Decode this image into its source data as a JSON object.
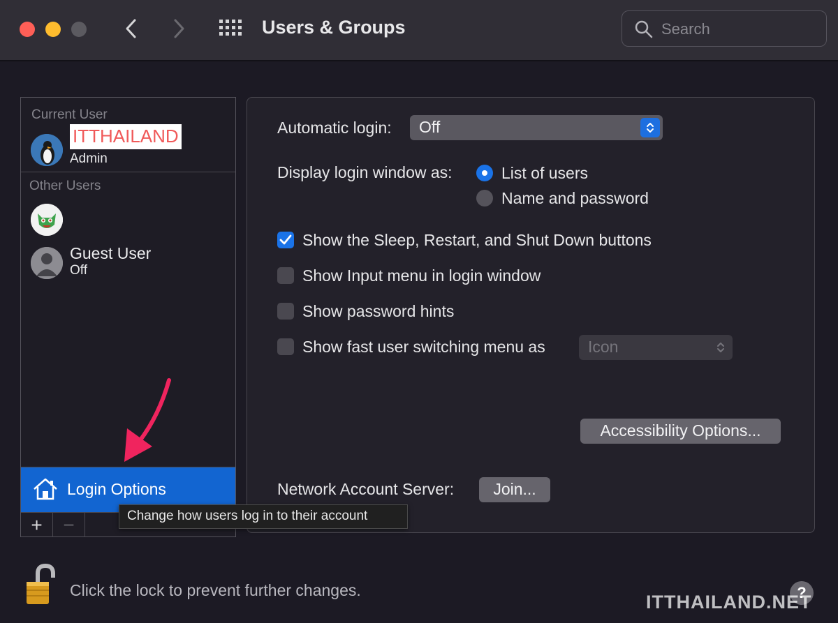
{
  "window": {
    "title": "Users & Groups",
    "search_placeholder": "Search"
  },
  "sidebar": {
    "current_user_label": "Current User",
    "current_user": {
      "name": "ITTHAILAND",
      "role": "Admin"
    },
    "other_users_label": "Other Users",
    "other_users": [
      {
        "name": "",
        "status": ""
      },
      {
        "name": "Guest User",
        "status": "Off"
      }
    ],
    "login_options_label": "Login Options",
    "add_symbol": "+",
    "remove_symbol": "−"
  },
  "tooltip": {
    "text": "Change how users log in to their account"
  },
  "panel": {
    "automatic_login": {
      "label": "Automatic login:",
      "value": "Off"
    },
    "display_login_window": {
      "label": "Display login window as:",
      "options": [
        {
          "label": "List of users",
          "selected": true
        },
        {
          "label": "Name and password",
          "selected": false
        }
      ]
    },
    "checkboxes": [
      {
        "label": "Show the Sleep, Restart, and Shut Down buttons",
        "checked": true
      },
      {
        "label": "Show Input menu in login window",
        "checked": false
      },
      {
        "label": "Show password hints",
        "checked": false
      },
      {
        "label": "Show fast user switching menu as",
        "checked": false
      }
    ],
    "fast_switching_value": "Icon",
    "accessibility_button": "Accessibility Options...",
    "network_account_server": {
      "label": "Network Account Server:",
      "button": "Join..."
    }
  },
  "footer": {
    "lock_text": "Click the lock to prevent further changes.",
    "help_symbol": "?",
    "watermark": "ITTHAILAND.NET"
  },
  "colors": {
    "accent": "#1a73e8",
    "selection": "#1265d1",
    "annotation_arrow": "#f0245e"
  }
}
